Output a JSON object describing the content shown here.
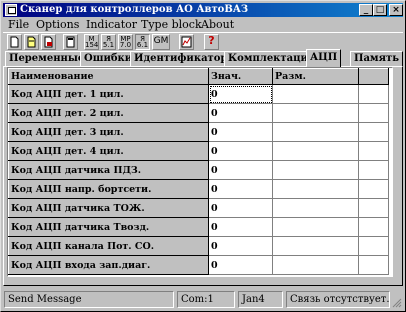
{
  "window": {
    "title": "Сканер для  контроллеров АО АвтоВАЗ",
    "minimize_glyph": "_",
    "maximize_glyph": "□",
    "close_glyph": "×"
  },
  "menu": [
    "File",
    "Options",
    "Indicator",
    "Type block",
    "About"
  ],
  "toolbar": {
    "buttons": [
      {
        "icon": "new-document-icon"
      },
      {
        "icon": "open-document-icon"
      },
      {
        "icon": "save-document-icon"
      },
      {
        "icon": "calculator-icon"
      },
      {
        "icon": "m154-icon",
        "line1": "M",
        "line2": "154"
      },
      {
        "icon": "ya51-icon",
        "line1": "Я",
        "line2": "5.1"
      },
      {
        "icon": "mp70-icon",
        "line1": "MP",
        "line2": "7.0"
      },
      {
        "icon": "ya61-icon",
        "line1": "Я",
        "line2": "6.1"
      },
      {
        "icon": "gm-icon",
        "line1": "GM",
        "line2": ""
      },
      {
        "icon": "chart-icon"
      },
      {
        "icon": "help-icon",
        "line1": "?",
        "line2": ""
      }
    ]
  },
  "tabs": [
    "Переменные",
    "Ошибки",
    "Идентификаторы",
    "Комплектация",
    "АЦП",
    "Память"
  ],
  "active_tab": "АЦП",
  "table": {
    "columns": [
      "Наименование",
      "Знач.",
      "Разм.",
      ""
    ],
    "rows": [
      {
        "name": "Код АЦП дет. 1 цил.",
        "value": "0",
        "unit": ""
      },
      {
        "name": "Код АЦП дет. 2 цил.",
        "value": "0",
        "unit": ""
      },
      {
        "name": "Код АЦП дет. 3 цил.",
        "value": "0",
        "unit": ""
      },
      {
        "name": "Код АЦП дет. 4 цил.",
        "value": "0",
        "unit": ""
      },
      {
        "name": "Код АЦП датчика ПДЗ.",
        "value": "0",
        "unit": ""
      },
      {
        "name": "Код АЦП напр. бортсети.",
        "value": "0",
        "unit": ""
      },
      {
        "name": "Код АЦП датчика ТОЖ.",
        "value": "0",
        "unit": ""
      },
      {
        "name": "Код АЦП датчика Твозд.",
        "value": "0",
        "unit": ""
      },
      {
        "name": "Код АЦП канала Пот. СО.",
        "value": "0",
        "unit": ""
      },
      {
        "name": "Код АЦП входа зап.диаг.",
        "value": "0",
        "unit": ""
      }
    ]
  },
  "status": {
    "message": "Send Message",
    "port": "Com:1",
    "block": "Jan4",
    "connection": "Связь отсутствует."
  }
}
